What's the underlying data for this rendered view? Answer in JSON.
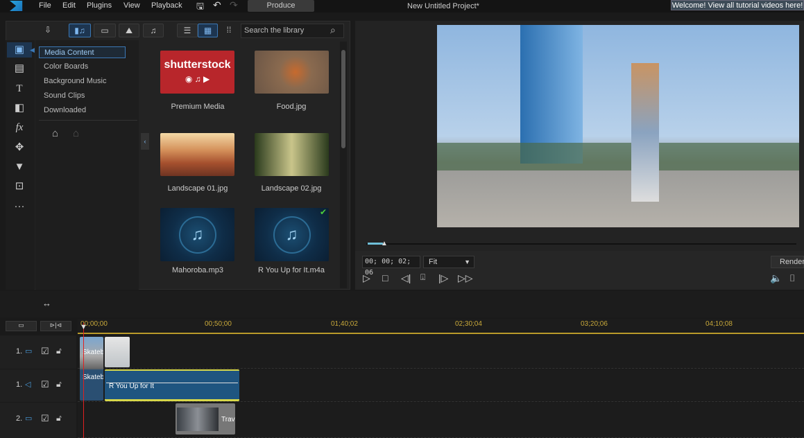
{
  "menubar": {
    "items": [
      "File",
      "Edit",
      "Plugins",
      "View",
      "Playback"
    ],
    "produce": "Produce",
    "title": "New Untitled Project*",
    "welcome": "Welcome! View all tutorial videos here!"
  },
  "library": {
    "search_placeholder": "Search the library",
    "categories": [
      "Media Content",
      "Color Boards",
      "Background Music",
      "Sound Clips",
      "Downloaded"
    ],
    "items": [
      {
        "name": "Premium Media",
        "logo": "shutterstock"
      },
      {
        "name": "Food.jpg"
      },
      {
        "name": "Landscape 01.jpg"
      },
      {
        "name": "Landscape 02.jpg"
      },
      {
        "name": "Mahoroba.mp3"
      },
      {
        "name": "R You Up for It.m4a",
        "checked": true
      }
    ]
  },
  "preview": {
    "timecode": "00; 00; 02; 06",
    "zoom": "Fit",
    "render": "Render",
    "progress_percent": 1
  },
  "timeline": {
    "ruler": [
      "00;00;00",
      "00;50;00",
      "01;40;02",
      "02;30;04",
      "03;20;06",
      "04;10;08"
    ],
    "tracks": [
      {
        "label": "1.",
        "type": "video",
        "clips": [
          "Skateb",
          ""
        ]
      },
      {
        "label": "1.",
        "type": "audio",
        "clips": [
          "Skateb",
          "R You Up for It"
        ]
      },
      {
        "label": "2.",
        "type": "video",
        "clips": [
          "Trav"
        ]
      }
    ]
  },
  "colors": {
    "accent": "#3b78b6",
    "ruler": "#c9a93a",
    "audio_clip": "#1f5580",
    "playhead": "#e02020"
  }
}
